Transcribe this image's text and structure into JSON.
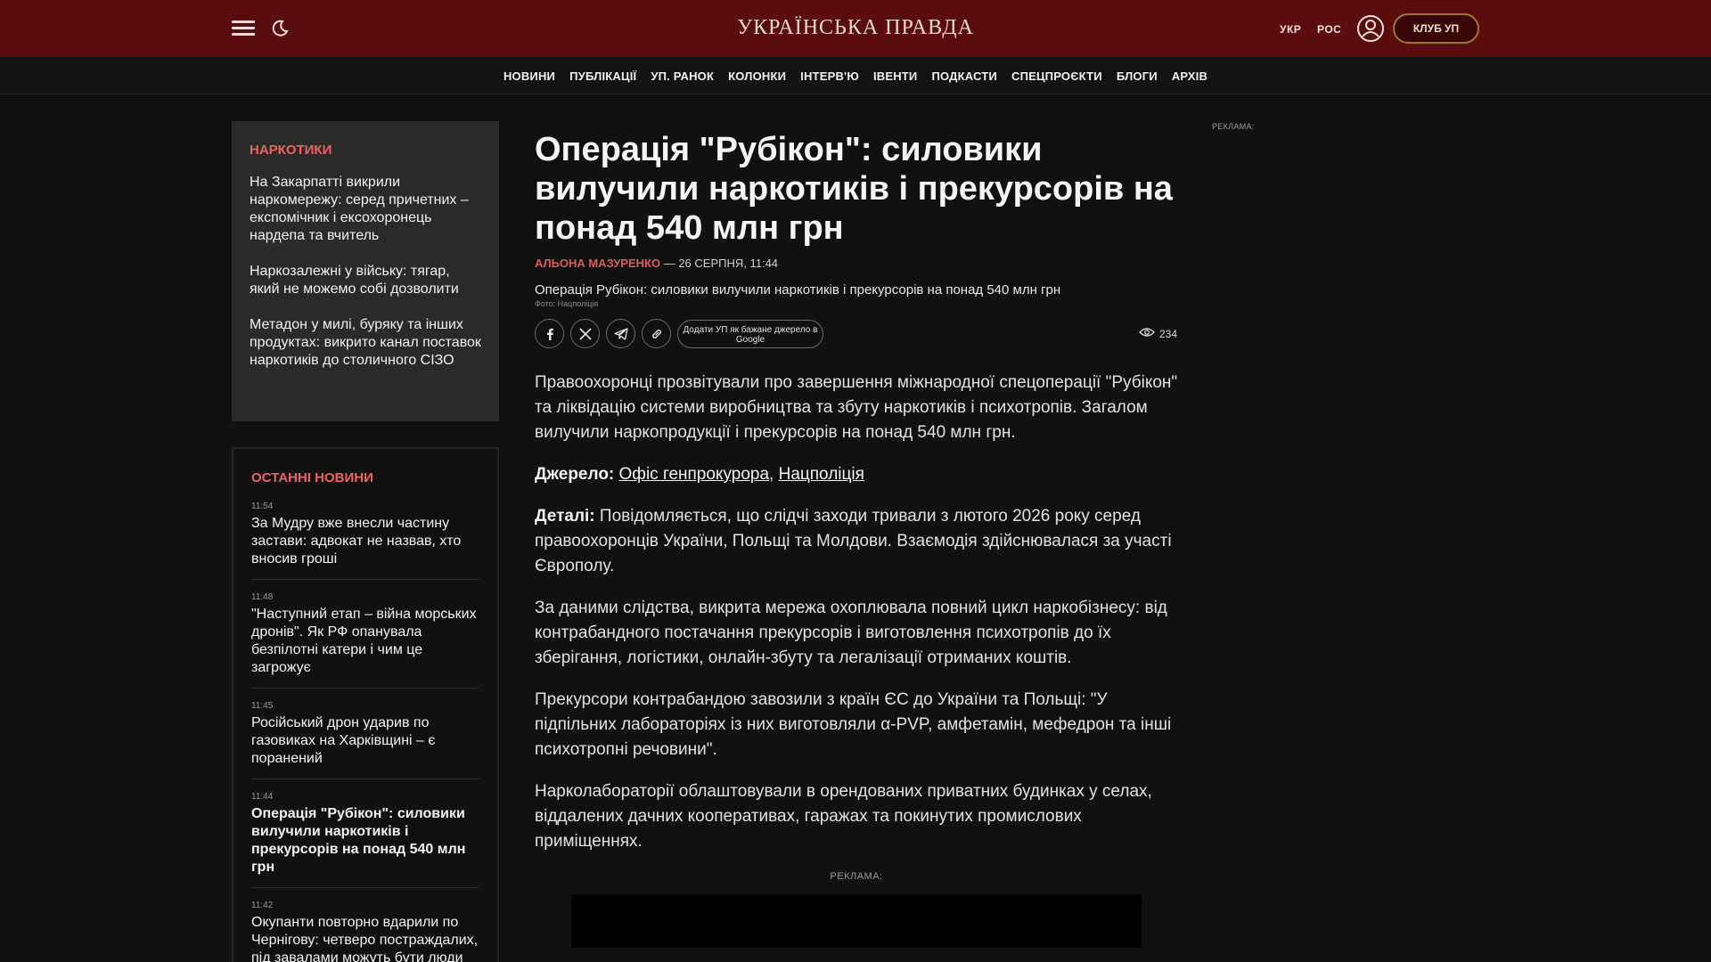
{
  "header": {
    "logo": "УКРАЇНСЬКА ПРАВДА",
    "lang_ukr": "УКР",
    "lang_ros": "РОС",
    "club_label": "КЛУБ УП"
  },
  "nav": {
    "items": [
      "НОВИНИ",
      "ПУБЛІКАЦІЇ",
      "УП. РАНОК",
      "КОЛОНКИ",
      "ІНТЕРВ'Ю",
      "ІВЕНТИ",
      "ПОДКАСТИ",
      "СПЕЦПРОЄКТИ",
      "БЛОГИ",
      "АРХІВ"
    ]
  },
  "tag_box": {
    "title": "НАРКОТИКИ",
    "items": [
      "На Закарпатті викрили наркомережу: серед причетних – експомічник і ексохоронець нардепа та вчитель",
      "Наркозалежні у війську: тягар, який не можемо собі дозволити",
      "Метадон у милі, буряку та інших продуктах: викрито канал поставок наркотиків до столичного СІЗО"
    ]
  },
  "latest_news": {
    "title": "ОСТАННІ НОВИНИ",
    "items": [
      {
        "time": "11:54",
        "title": "За Мудру вже внесли частину застави: адвокат не назвав, хто вносив гроші"
      },
      {
        "time": "11:48",
        "title": "\"Наступний етап – війна морських дронів\". Як РФ опанувала безпілотні катери і чим це загрожує"
      },
      {
        "time": "11:45",
        "title": "Російський дрон ударив по газовиках на Харківщині – є поранений"
      },
      {
        "time": "11:44",
        "title": "Операція \"Рубікон\": силовики вилучили наркотиків і прекурсорів на понад 540 млн грн"
      },
      {
        "time": "11:42",
        "title": "Окупанти повторно вдарили по Чернігову: четверо постраждалих, під завалами можуть бути люди"
      }
    ]
  },
  "article": {
    "headline": "Операція \"Рубікон\": силовики вилучили наркотиків і прекурсорів на понад 540 млн грн",
    "author": "АЛЬОНА МАЗУРЕНКО",
    "date": "— 26 СЕРПНЯ, 11:44",
    "photo_alt": "Операція Рубікон: силовики вилучили наркотиків і прекурсорів на понад 540 млн грн",
    "photo_credit": "Фото: Нацполіція",
    "google_button": "Додати УП як бажане джерело в Google",
    "views": "234",
    "p1": "Правоохоронці прозвітували про завершення міжнародної спецоперації \"Рубікон\" та ліквідацію системи виробництва та збуту наркотиків і психотропів. Загалом вилучили наркопродукції і прекурсорів на понад 540 млн грн.",
    "source_label": "Джерело:",
    "source_link1": "Офіс генпрокурора",
    "source_sep": ",",
    "source_link2": "Нацполіція",
    "details_label": "Деталі:",
    "details_text": "Повідомляється, що слідчі заходи тривали з лютого 2026 року серед правоохоронців України, Польщі та Молдови. Взаємодія здійснювалася за участі Європолу.",
    "p3": "За даними слідства, викрита мережа охоплювала повний цикл наркобізнесу: від контрабандного постачання прекурсорів і виготовлення психотропів до їх зберігання, логістики, онлайн-збуту та легалізації отриманих коштів.",
    "p4": "Прекурсори контрабандою завозили з країн ЄС до України та Польщі: \"У підпільних лабораторіях із них виготовляли α-PVP, амфетамін, мефедрон та інші психотропні речовини\".",
    "p5": "Нарколабораторії облаштовували в орендованих приватних будинках у селах, віддалених дачних кооперативах, гаражах та покинутих промислових приміщеннях.",
    "ad_label": "РЕКЛАМА:"
  },
  "right_ad": {
    "label": "РЕКЛАМА:"
  },
  "colors": {
    "header_bg": "#5b0c0c",
    "accent_red": "#f06262",
    "page_bg": "#111111",
    "box_bg": "#2a2a2a"
  }
}
